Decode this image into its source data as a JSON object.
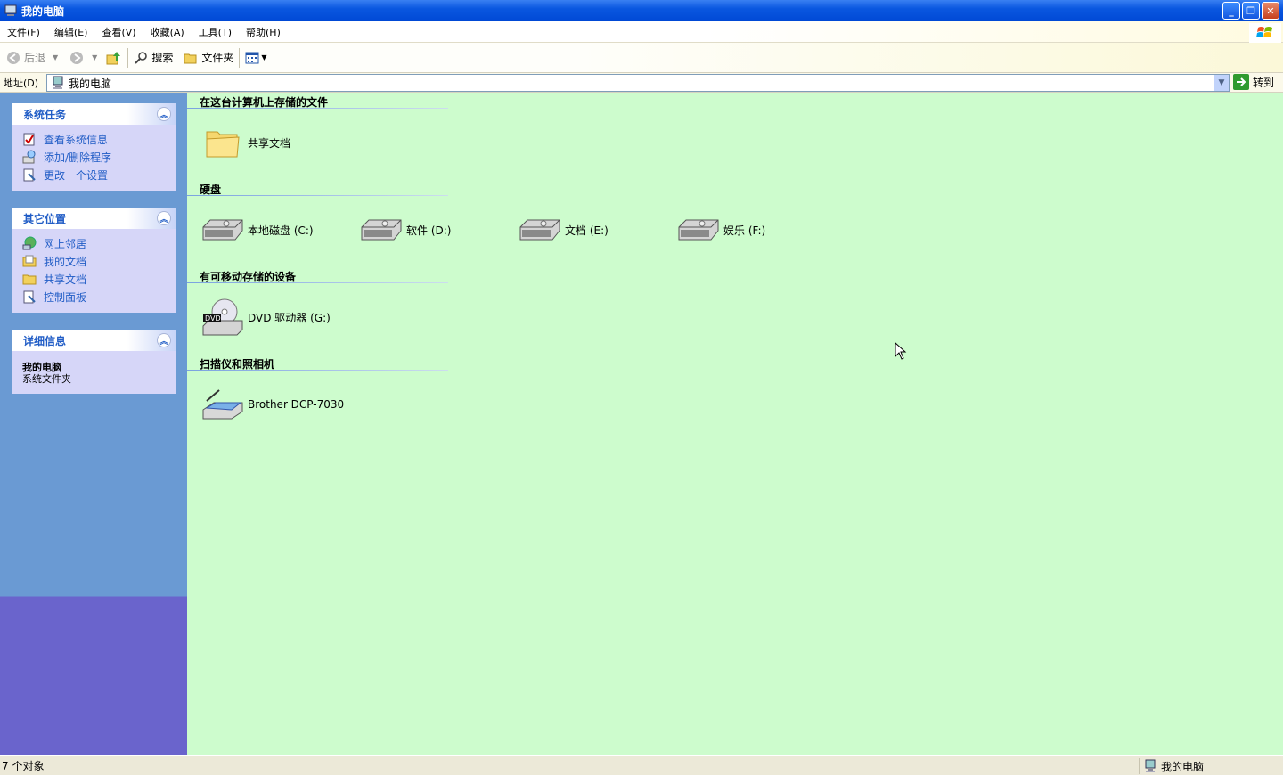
{
  "window": {
    "title": "我的电脑"
  },
  "menu": [
    "文件(F)",
    "编辑(E)",
    "查看(V)",
    "收藏(A)",
    "工具(T)",
    "帮助(H)"
  ],
  "toolbar": {
    "back": "后退",
    "search": "搜索",
    "folders": "文件夹"
  },
  "address": {
    "label": "地址(D)",
    "value": "我的电脑",
    "go": "转到"
  },
  "sidebar": {
    "system_tasks": {
      "title": "系统任务",
      "items": [
        "查看系统信息",
        "添加/删除程序",
        "更改一个设置"
      ]
    },
    "other_places": {
      "title": "其它位置",
      "items": [
        "网上邻居",
        "我的文档",
        "共享文档",
        "控制面板"
      ]
    },
    "details": {
      "title": "详细信息",
      "name": "我的电脑",
      "type": "系统文件夹"
    }
  },
  "groups": {
    "files": {
      "title": "在这台计算机上存储的文件",
      "items": [
        "共享文档"
      ]
    },
    "hard_disks": {
      "title": "硬盘",
      "items": [
        "本地磁盘 (C:)",
        "软件 (D:)",
        "文档 (E:)",
        "娱乐 (F:)"
      ]
    },
    "removable": {
      "title": "有可移动存储的设备",
      "items": [
        "DVD 驱动器 (G:)"
      ]
    },
    "scanners": {
      "title": "扫描仪和照相机",
      "items": [
        "Brother DCP-7030"
      ]
    }
  },
  "status": {
    "objects": "7 个对象",
    "location": "我的电脑"
  },
  "colors": {
    "content_bg": "#cdfccd",
    "sidebar_bg": "#6a9ad3",
    "titlebar": "#0a57e0",
    "link": "#215dc6"
  }
}
